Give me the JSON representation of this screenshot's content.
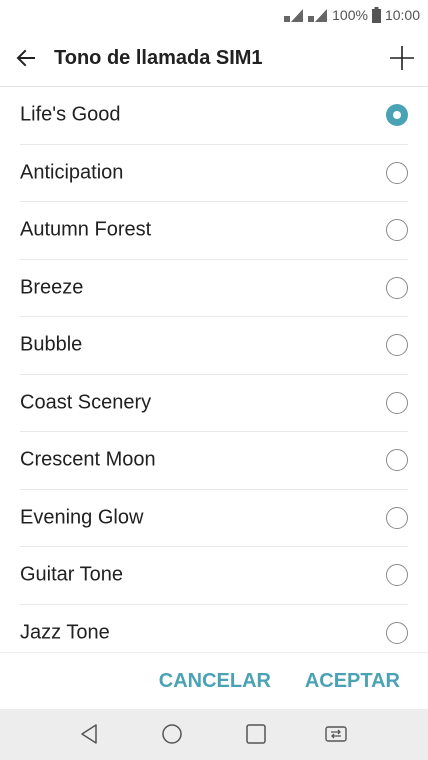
{
  "status_bar": {
    "battery": "100%",
    "time": "10:00",
    "icons": [
      "sim1-signal-icon",
      "sim2-signal-icon",
      "battery-icon"
    ]
  },
  "app_bar": {
    "title": "Tono de llamada SIM1",
    "back_icon": "arrow-left-icon",
    "add_icon": "plus-icon"
  },
  "ringtones": [
    {
      "label": "Life's Good",
      "selected": true
    },
    {
      "label": "Anticipation",
      "selected": false
    },
    {
      "label": "Autumn Forest",
      "selected": false
    },
    {
      "label": "Breeze",
      "selected": false
    },
    {
      "label": "Bubble",
      "selected": false
    },
    {
      "label": "Coast Scenery",
      "selected": false
    },
    {
      "label": "Crescent Moon",
      "selected": false
    },
    {
      "label": "Evening Glow",
      "selected": false
    },
    {
      "label": "Guitar Tone",
      "selected": false
    },
    {
      "label": "Jazz Tone",
      "selected": false
    }
  ],
  "actions": {
    "cancel_label": "CANCELAR",
    "accept_label": "ACEPTAR"
  },
  "nav_bar": {
    "icons": [
      "back-triangle-icon",
      "home-circle-icon",
      "recent-apps-icon",
      "sim-switch-icon"
    ]
  },
  "colors": {
    "accent": "#4aa3b5",
    "nav_background": "#ededed",
    "text": "#212121"
  }
}
